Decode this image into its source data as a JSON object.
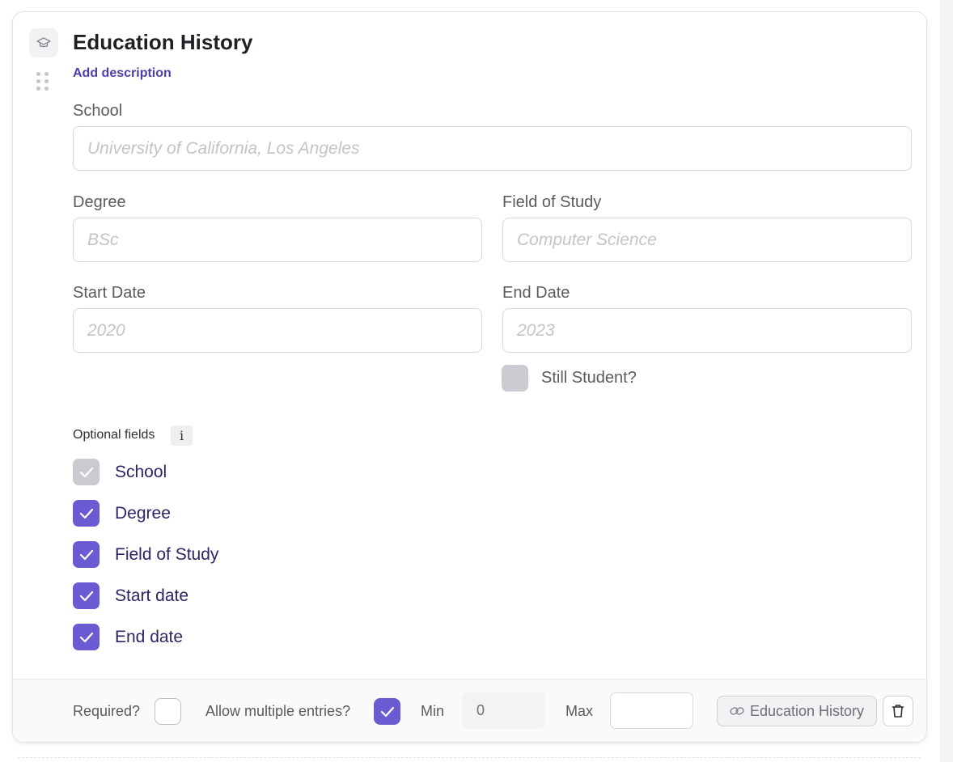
{
  "block": {
    "title": "Education History",
    "add_description": "Add description",
    "icon": "graduation-cap-icon"
  },
  "fields": {
    "school": {
      "label": "School",
      "placeholder": "University of California, Los Angeles"
    },
    "degree": {
      "label": "Degree",
      "placeholder": "BSc"
    },
    "field_of_study": {
      "label": "Field of Study",
      "placeholder": "Computer Science"
    },
    "start_date": {
      "label": "Start Date",
      "placeholder": "2020"
    },
    "end_date": {
      "label": "End Date",
      "placeholder": "2023"
    },
    "still_student": {
      "label": "Still Student?",
      "checked": false
    }
  },
  "optional_fields": {
    "label": "Optional fields",
    "info": "i",
    "items": [
      {
        "label": "School",
        "checked": true,
        "disabled": true
      },
      {
        "label": "Degree",
        "checked": true,
        "disabled": false
      },
      {
        "label": "Field of Study",
        "checked": true,
        "disabled": false
      },
      {
        "label": "Start date",
        "checked": true,
        "disabled": false
      },
      {
        "label": "End date",
        "checked": true,
        "disabled": false
      }
    ]
  },
  "footer": {
    "required_label": "Required?",
    "required_checked": false,
    "multiple_label": "Allow multiple entries?",
    "multiple_checked": true,
    "min_label": "Min",
    "min_value": "0",
    "max_label": "Max",
    "max_value": "",
    "link_label": "Education History"
  },
  "colors": {
    "accent": "#6b5bd2",
    "link": "#4c40a8",
    "disabled": "#cacbd1"
  }
}
